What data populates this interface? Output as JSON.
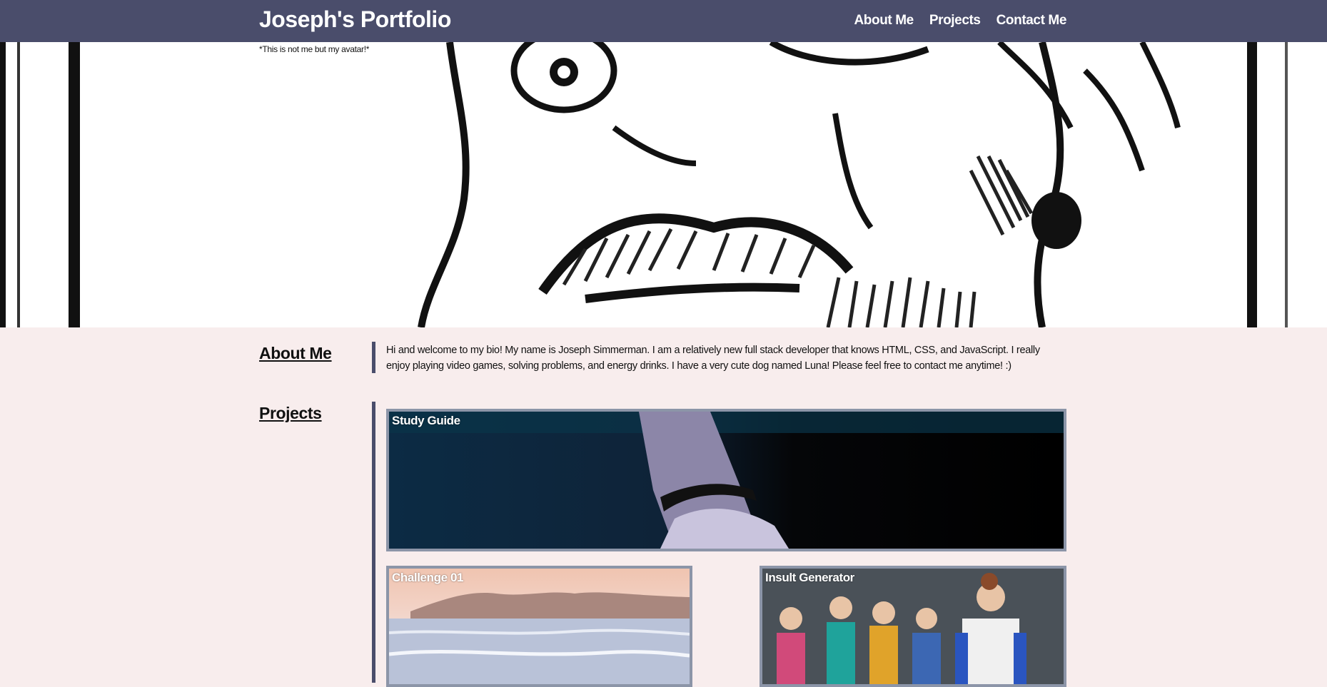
{
  "header": {
    "brand": "Joseph's Portfolio",
    "nav": [
      "About Me",
      "Projects",
      "Contact Me"
    ]
  },
  "hero": {
    "caption": "*This is not me but my avatar!*"
  },
  "about": {
    "title": "About Me",
    "bio": "Hi and welcome to my bio! My name is Joseph Simmerman. I am a relatively new full stack developer that knows HTML, CSS, and JavaScript. I really enjoy playing video games, solving problems, and energy drinks. I have a very cute dog named Luna! Please feel free to contact me anytime! :)"
  },
  "projects": {
    "title": "Projects",
    "items": [
      "Study Guide",
      "Challenge 01",
      "Insult Generator"
    ]
  },
  "colors": {
    "header": "#4a4d6b",
    "page": "#f8eded",
    "card_border": "#8c95a8"
  }
}
